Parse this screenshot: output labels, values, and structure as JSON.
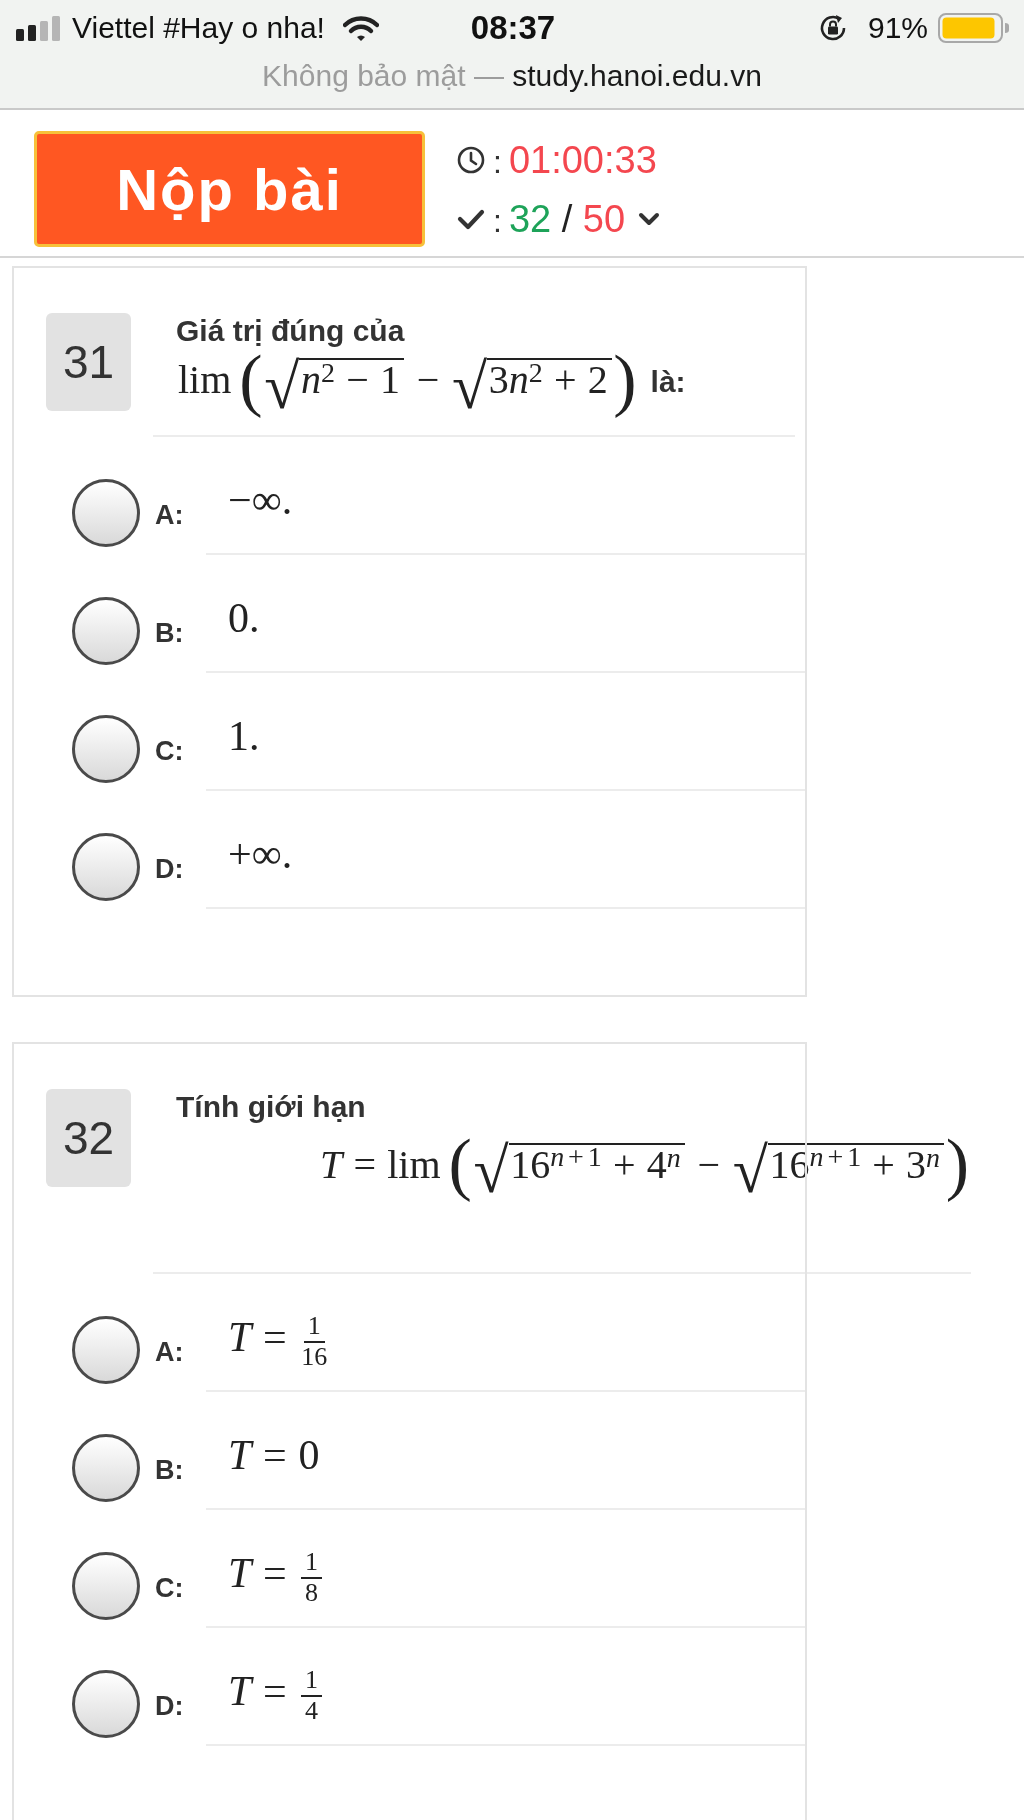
{
  "status_bar": {
    "carrier": "Viettel #Hay o nha!",
    "time": "08:37",
    "battery_percent": "91%"
  },
  "address_bar": {
    "security": "Không bảo mật —",
    "domain": "study.hanoi.edu.vn"
  },
  "toolbar": {
    "submit_button": "Nộp bài",
    "timer": {
      "separator": ":",
      "value": "01:00:33"
    },
    "progress": {
      "separator": ":",
      "answered": "32",
      "slash": "/",
      "total": "50"
    }
  },
  "questions": [
    {
      "number": "31",
      "prompt": "Giá trị đúng của",
      "formula": {
        "display": false,
        "parts": [
          {
            "kind": "fn",
            "text": "lim"
          },
          {
            "kind": "paren",
            "open": "(",
            "close": ")",
            "children": [
              {
                "kind": "sqrt",
                "sign": "√",
                "children": [
                  {
                    "kind": "italic",
                    "text": "n"
                  },
                  {
                    "kind": "sup",
                    "children": [
                      {
                        "kind": "upright",
                        "text": "2"
                      }
                    ]
                  },
                  {
                    "kind": "op",
                    "text": "−"
                  },
                  {
                    "kind": "upright",
                    "text": "1"
                  }
                ]
              },
              {
                "kind": "op",
                "text": "−"
              },
              {
                "kind": "sqrt",
                "sign": "√",
                "children": [
                  {
                    "kind": "upright",
                    "text": "3"
                  },
                  {
                    "kind": "italic",
                    "text": "n"
                  },
                  {
                    "kind": "sup",
                    "children": [
                      {
                        "kind": "upright",
                        "text": "2"
                      }
                    ]
                  },
                  {
                    "kind": "op",
                    "text": "+"
                  },
                  {
                    "kind": "upright",
                    "text": "2"
                  }
                ]
              }
            ]
          }
        ]
      },
      "suffix": "là:",
      "options": [
        {
          "label": "A:",
          "selected": false,
          "value": [
            {
              "kind": "upright",
              "text": "−∞."
            }
          ]
        },
        {
          "label": "B:",
          "selected": false,
          "value": [
            {
              "kind": "upright",
              "text": "0."
            }
          ]
        },
        {
          "label": "C:",
          "selected": false,
          "value": [
            {
              "kind": "upright",
              "text": "1."
            }
          ]
        },
        {
          "label": "D:",
          "selected": false,
          "value": [
            {
              "kind": "upright",
              "text": "+∞."
            }
          ]
        }
      ]
    },
    {
      "number": "32",
      "prompt": "Tính giới hạn",
      "formula": {
        "display": true,
        "parts": [
          {
            "kind": "italic",
            "text": "T"
          },
          {
            "kind": "op",
            "text": "="
          },
          {
            "kind": "fn",
            "text": "lim"
          },
          {
            "kind": "paren",
            "open": "(",
            "close": ")",
            "children": [
              {
                "kind": "sqrt",
                "sign": "√",
                "children": [
                  {
                    "kind": "upright",
                    "text": "16"
                  },
                  {
                    "kind": "sup",
                    "children": [
                      {
                        "kind": "italic",
                        "text": "n"
                      },
                      {
                        "kind": "op",
                        "text": "+"
                      },
                      {
                        "kind": "upright",
                        "text": "1"
                      }
                    ]
                  },
                  {
                    "kind": "op",
                    "text": "+"
                  },
                  {
                    "kind": "upright",
                    "text": "4"
                  },
                  {
                    "kind": "sup",
                    "children": [
                      {
                        "kind": "italic",
                        "text": "n"
                      }
                    ]
                  }
                ]
              },
              {
                "kind": "op",
                "text": "−"
              },
              {
                "kind": "sqrt",
                "sign": "√",
                "children": [
                  {
                    "kind": "upright",
                    "text": "16"
                  },
                  {
                    "kind": "sup",
                    "children": [
                      {
                        "kind": "italic",
                        "text": "n"
                      },
                      {
                        "kind": "op",
                        "text": "+"
                      },
                      {
                        "kind": "upright",
                        "text": "1"
                      }
                    ]
                  },
                  {
                    "kind": "op",
                    "text": "+"
                  },
                  {
                    "kind": "upright",
                    "text": "3"
                  },
                  {
                    "kind": "sup",
                    "children": [
                      {
                        "kind": "italic",
                        "text": "n"
                      }
                    ]
                  }
                ]
              }
            ]
          }
        ]
      },
      "options": [
        {
          "label": "A:",
          "selected": false,
          "value": [
            {
              "kind": "italic",
              "text": "T"
            },
            {
              "kind": "op",
              "text": "="
            },
            {
              "kind": "frac",
              "num": [
                {
                  "kind": "upright",
                  "text": "1"
                }
              ],
              "den": [
                {
                  "kind": "upright",
                  "text": "16"
                }
              ]
            }
          ]
        },
        {
          "label": "B:",
          "selected": false,
          "value": [
            {
              "kind": "italic",
              "text": "T"
            },
            {
              "kind": "op",
              "text": "="
            },
            {
              "kind": "upright",
              "text": "0"
            }
          ]
        },
        {
          "label": "C:",
          "selected": false,
          "value": [
            {
              "kind": "italic",
              "text": "T"
            },
            {
              "kind": "op",
              "text": "="
            },
            {
              "kind": "frac",
              "num": [
                {
                  "kind": "upright",
                  "text": "1"
                }
              ],
              "den": [
                {
                  "kind": "upright",
                  "text": "8"
                }
              ]
            }
          ]
        },
        {
          "label": "D:",
          "selected": false,
          "value": [
            {
              "kind": "italic",
              "text": "T"
            },
            {
              "kind": "op",
              "text": "="
            },
            {
              "kind": "frac",
              "num": [
                {
                  "kind": "upright",
                  "text": "1"
                }
              ],
              "den": [
                {
                  "kind": "upright",
                  "text": "4"
                }
              ]
            }
          ]
        }
      ]
    }
  ]
}
